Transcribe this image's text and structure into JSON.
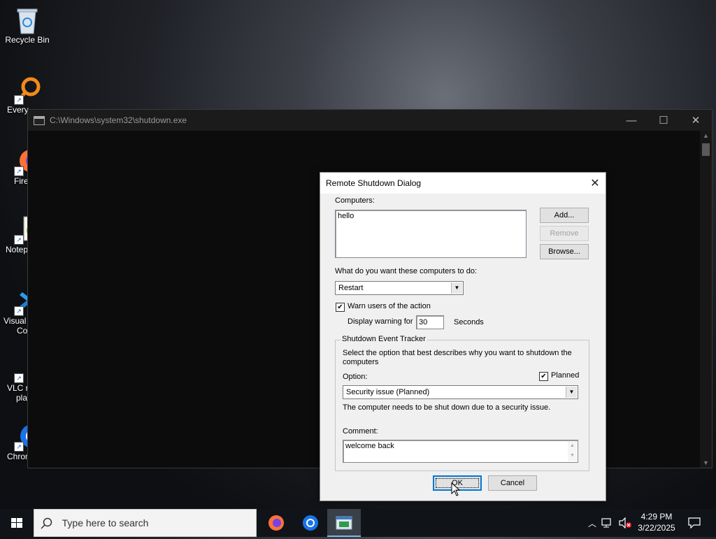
{
  "desktop": {
    "icons": [
      {
        "label": "Recycle Bin",
        "icon": "recycle-bin-icon"
      },
      {
        "label": "Every",
        "icon": "everything-search-icon"
      },
      {
        "label": "Fire",
        "icon": "firefox-icon"
      },
      {
        "label": "Notep",
        "icon": "notepad-plus-plus-icon"
      },
      {
        "label": "Visual",
        "label2": "Co",
        "icon": "vscode-icon"
      },
      {
        "label": "VLC m",
        "label2": "pla",
        "icon": "vlc-icon"
      },
      {
        "label": "Chrom",
        "icon": "chrome-icon"
      }
    ]
  },
  "console": {
    "title": "C:\\Windows\\system32\\shutdown.exe",
    "buttons": {
      "minimize": "—",
      "maximize": "☐",
      "close": "✕"
    }
  },
  "dialog": {
    "title": "Remote Shutdown Dialog",
    "close": "✕",
    "computers_label": "Computers:",
    "computers_value": "hello",
    "add_button": "Add...",
    "remove_button": "Remove",
    "browse_button": "Browse...",
    "action_label": "What do you want these computers to do:",
    "action_value": "Restart",
    "warn_label": "Warn users of the action",
    "warn_checked": true,
    "display_warning_label": "Display warning for",
    "display_warning_value": "30",
    "seconds_label": "Seconds",
    "tracker": {
      "legend": "Shutdown Event Tracker",
      "description": "Select the option that best describes why you want to shutdown the computers",
      "planned_label": "Planned",
      "planned_checked": true,
      "option_label": "Option:",
      "option_value": "Security issue (Planned)",
      "option_description": "The computer needs to be shut down due to a security issue.",
      "comment_label": "Comment:",
      "comment_value": "welcome back"
    },
    "ok_button": "OK",
    "cancel_button": "Cancel"
  },
  "taskbar": {
    "search_placeholder": "Type here to search",
    "apps": [
      "firefox-icon",
      "chrome-icon",
      "shutdown-app-icon"
    ],
    "time": "4:29 PM",
    "date": "3/22/2025"
  }
}
